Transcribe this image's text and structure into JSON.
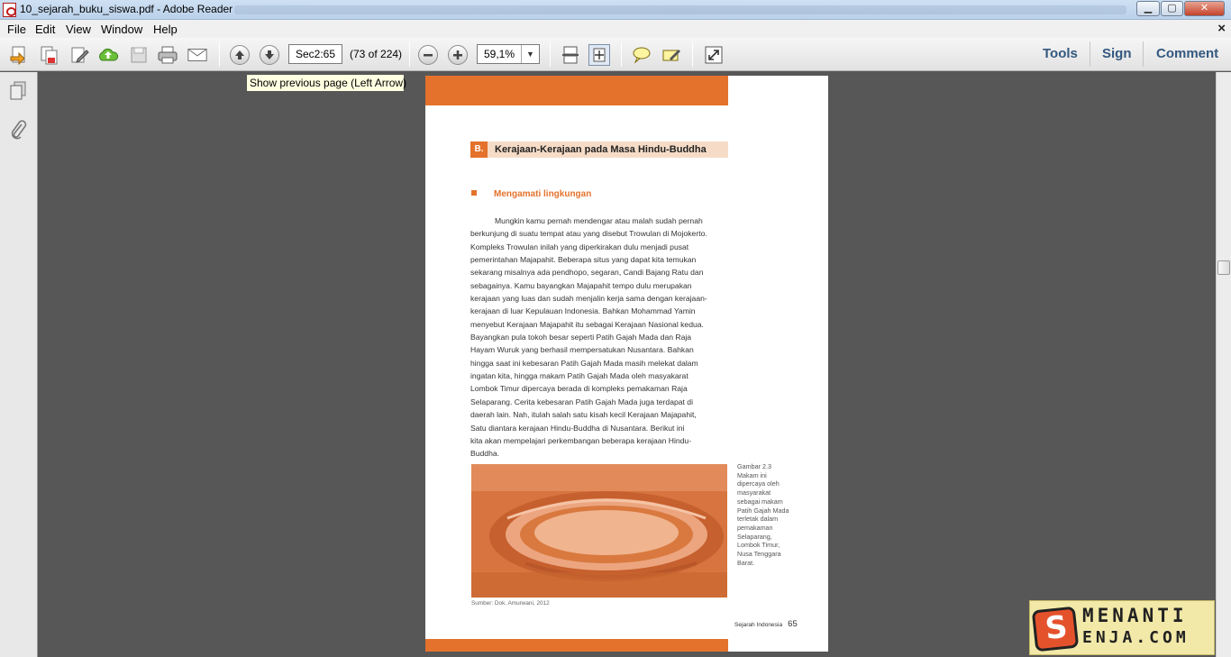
{
  "window": {
    "title": "10_sejarah_buku_siswa.pdf - Adobe Reader",
    "buttons": {
      "minimize": "▁",
      "maximize": "▢",
      "close": "✕"
    }
  },
  "menu": {
    "items": [
      "File",
      "Edit",
      "View",
      "Window",
      "Help"
    ],
    "close_doc": "×"
  },
  "toolbar": {
    "page_label": "Sec2:65",
    "page_count": "(73 of 224)",
    "zoom": "59,1%",
    "links": {
      "tools": "Tools",
      "sign": "Sign",
      "comment": "Comment"
    },
    "icons": [
      "create-pdf-icon",
      "combine-pdf-icon",
      "edit-pdf-icon",
      "upload-cloud-icon",
      "save-icon",
      "print-icon",
      "email-icon",
      "previous-page-icon",
      "next-page-icon",
      "zoom-out-icon",
      "zoom-in-icon",
      "scroll-mode-icon",
      "fit-page-icon",
      "comment-icon",
      "highlight-icon",
      "full-screen-icon"
    ]
  },
  "tooltip": "Show previous page (Left Arrow)",
  "leftnav": {
    "icons": [
      "page-thumbnails-icon",
      "attachments-icon"
    ]
  },
  "document": {
    "section_letter": "B.",
    "section_title": "Kerajaan-Kerajaan pada Masa Hindu-Buddha",
    "subheading": "Mengamati lingkungan",
    "body_lines": [
      "Mungkin kamu pernah mendengar atau malah sudah pernah",
      "berkunjung di suatu tempat atau yang disebut Trowulan di Mojokerto.",
      "Kompleks Trowulan inilah yang diperkirakan dulu menjadi pusat",
      "pemerintahan Majapahit. Beberapa situs yang dapat kita temukan",
      "sekarang misalnya ada pendhopo, segaran, Candi Bajang Ratu dan",
      "sebagainya. Kamu bayangkan Majapahit tempo dulu merupakan",
      "kerajaan yang luas dan sudah menjalin kerja sama dengan kerajaan-",
      "kerajaan di luar Kepulauan Indonesia. Bahkan Mohammad Yamin",
      "menyebut Kerajaan Majapahit itu sebagai Kerajaan Nasional kedua.",
      "Bayangkan pula tokoh besar seperti Patih Gajah Mada dan Raja",
      "Hayam Wuruk yang berhasil mempersatukan Nusantara. Bahkan",
      "hingga saat ini kebesaran Patih Gajah Mada masih melekat dalam",
      "ingatan kita, hingga makam Patih Gajah Mada oleh masyakarat",
      "Lombok Timur dipercaya berada di kompleks pemakaman Raja",
      "Selaparang. Cerita kebesaran Patih Gajah Mada juga terdapat di",
      "daerah lain. Nah, itulah salah satu kisah kecil Kerajaan Majapahit,",
      "Satu diantara kerajaan Hindu-Buddha di Nusantara. Berikut ini",
      "kita akan mempelajari perkembangan beberapa kerajaan Hindu-",
      "Buddha."
    ],
    "caption_lines": [
      "Gambar 2.3",
      "Makam ini",
      "dipercaya oleh",
      "masyarakat",
      "sebagai makam",
      "Patih Gajah Mada",
      "terletak dalam",
      "pemakaman",
      "Selaparang,",
      "Lombok Timur,",
      "Nusa Tenggara",
      "Barat."
    ],
    "source": "Sumber: Dok. Amurwani, 2012",
    "footer_title": "Sejarah Indonesia",
    "page_number": "65",
    "accent_color": "#e4722c"
  },
  "watermark": {
    "line1": "MENANTI",
    "line2": "ENJA.COM",
    "badge": "S"
  }
}
